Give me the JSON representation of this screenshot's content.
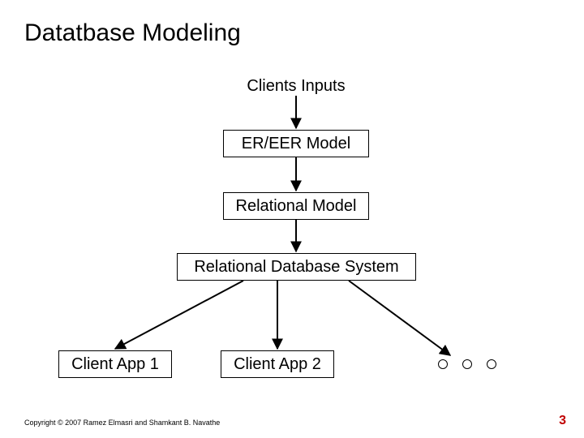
{
  "title": "Datatbase Modeling",
  "labels": {
    "clients_inputs": "Clients Inputs",
    "er_eer": "ER/EER Model",
    "relational_model": "Relational Model",
    "relational_db_system": "Relational Database System",
    "client_app_1": "Client App 1",
    "client_app_2": "Client App 2"
  },
  "footer": "Copyright © 2007 Ramez Elmasri and Shamkant B. Navathe",
  "page_number": "3"
}
